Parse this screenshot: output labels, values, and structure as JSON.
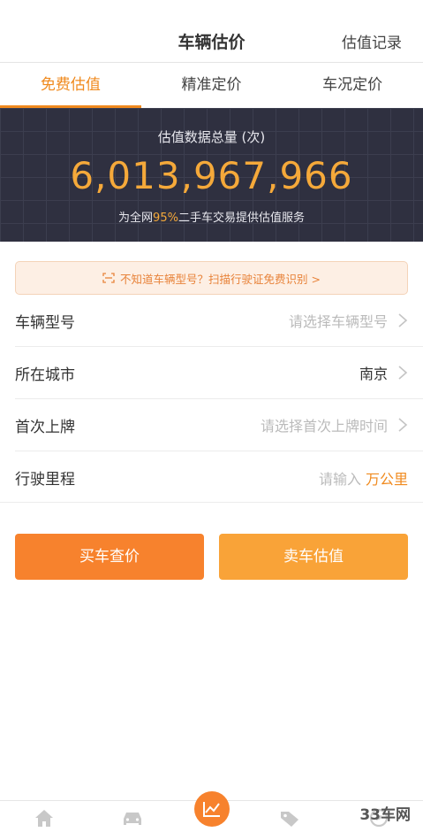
{
  "header": {
    "title": "车辆估价",
    "right_link": "估值记录"
  },
  "tabs": [
    {
      "label": "免费估值",
      "active": true
    },
    {
      "label": "精准定价",
      "active": false
    },
    {
      "label": "车况定价",
      "active": false
    }
  ],
  "banner": {
    "label": "估值数据总量 (次)",
    "total": "6,013,967,966",
    "desc_prefix": "为全网",
    "desc_highlight": "95%",
    "desc_suffix": "二手车交易提供估值服务"
  },
  "scan_tip": {
    "text": "不知道车辆型号？扫描行驶证免费识别 >",
    "icon": "scan-icon"
  },
  "form": {
    "model": {
      "label": "车辆型号",
      "placeholder": "请选择车辆型号"
    },
    "city": {
      "label": "所在城市",
      "value": "南京"
    },
    "first_reg": {
      "label": "首次上牌",
      "placeholder": "请选择首次上牌时间"
    },
    "mileage": {
      "label": "行驶里程",
      "placeholder": "请输入",
      "unit": "万公里"
    }
  },
  "buttons": {
    "buy": "买车查价",
    "sell": "卖车估值"
  },
  "tabbar": {
    "icons": [
      "home-icon",
      "car-icon",
      "chart-icon",
      "tag-icon",
      "compass-icon"
    ]
  },
  "watermark": "33车网",
  "colors": {
    "accent": "#f08a1e",
    "banner_bg": "#2f3040",
    "number": "#f5a93a",
    "buy_button": "#f7822d",
    "sell_button": "#f9a338"
  }
}
